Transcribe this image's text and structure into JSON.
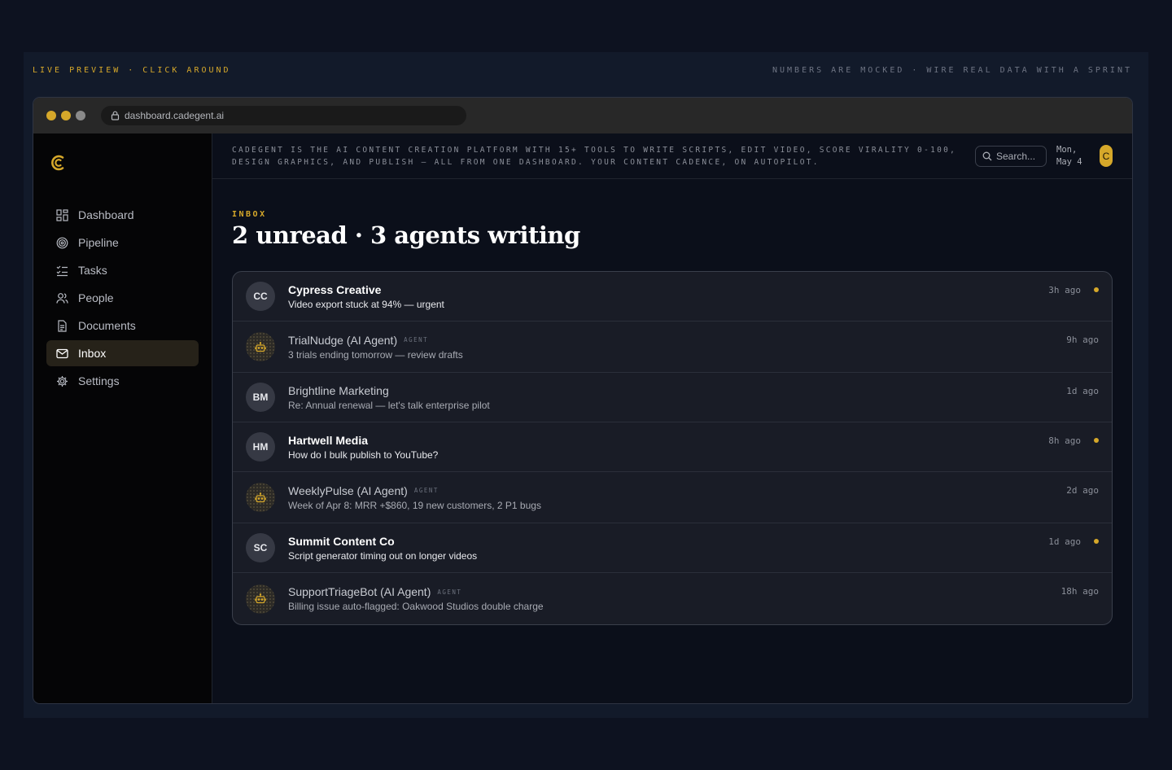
{
  "banner": {
    "left": "LIVE PREVIEW · CLICK AROUND",
    "right": "NUMBERS ARE MOCKED · WIRE REAL DATA WITH A SPRINT"
  },
  "browser": {
    "url": "dashboard.cadegent.ai",
    "traffic_colors": [
      "#d6a82a",
      "#d6a82a",
      "#8a8a8a"
    ]
  },
  "sidebar": {
    "logo_icon": "cadegent-c-logo",
    "items": [
      {
        "label": "Dashboard",
        "icon": "grid-icon"
      },
      {
        "label": "Pipeline",
        "icon": "target-icon"
      },
      {
        "label": "Tasks",
        "icon": "checklist-icon"
      },
      {
        "label": "People",
        "icon": "people-icon"
      },
      {
        "label": "Documents",
        "icon": "document-icon"
      },
      {
        "label": "Inbox",
        "icon": "mail-icon",
        "active": true
      },
      {
        "label": "Settings",
        "icon": "gear-icon"
      }
    ]
  },
  "header": {
    "tagline_line1": "CADEGENT IS THE AI CONTENT CREATION PLATFORM WITH 15+ TOOLS TO WRITE SCRIPTS, EDIT VIDEO, SCORE VIRALITY 0-100,",
    "tagline_line2": "DESIGN GRAPHICS, AND PUBLISH — ALL FROM ONE DASHBOARD. YOUR CONTENT CADENCE, ON AUTOPILOT.",
    "search_placeholder": "Search...",
    "date_line1": "Mon,",
    "date_line2": "May 4",
    "user_initial": "C"
  },
  "inbox": {
    "label": "INBOX",
    "title": "2 unread · 3 agents writing",
    "agent_tag": "AGENT",
    "accent": "#d6a82a",
    "messages": [
      {
        "initials": "CC",
        "name": "Cypress Creative",
        "preview": "Video export stuck at 94% — urgent",
        "time": "3h ago",
        "unread": true,
        "agent": false
      },
      {
        "initials": "",
        "name": "TrialNudge (AI Agent)",
        "preview": "3 trials ending tomorrow — review drafts",
        "time": "9h ago",
        "unread": false,
        "agent": true
      },
      {
        "initials": "BM",
        "name": "Brightline Marketing",
        "preview": "Re: Annual renewal — let's talk enterprise pilot",
        "time": "1d ago",
        "unread": false,
        "agent": false
      },
      {
        "initials": "HM",
        "name": "Hartwell Media",
        "preview": "How do I bulk publish to YouTube?",
        "time": "8h ago",
        "unread": true,
        "agent": false
      },
      {
        "initials": "",
        "name": "WeeklyPulse (AI Agent)",
        "preview": "Week of Apr 8: MRR +$860, 19 new customers, 2 P1 bugs",
        "time": "2d ago",
        "unread": false,
        "agent": true
      },
      {
        "initials": "SC",
        "name": "Summit Content Co",
        "preview": "Script generator timing out on longer videos",
        "time": "1d ago",
        "unread": true,
        "agent": false
      },
      {
        "initials": "",
        "name": "SupportTriageBot (AI Agent)",
        "preview": "Billing issue auto-flagged: Oakwood Studios double charge",
        "time": "18h ago",
        "unread": false,
        "agent": true
      }
    ]
  }
}
